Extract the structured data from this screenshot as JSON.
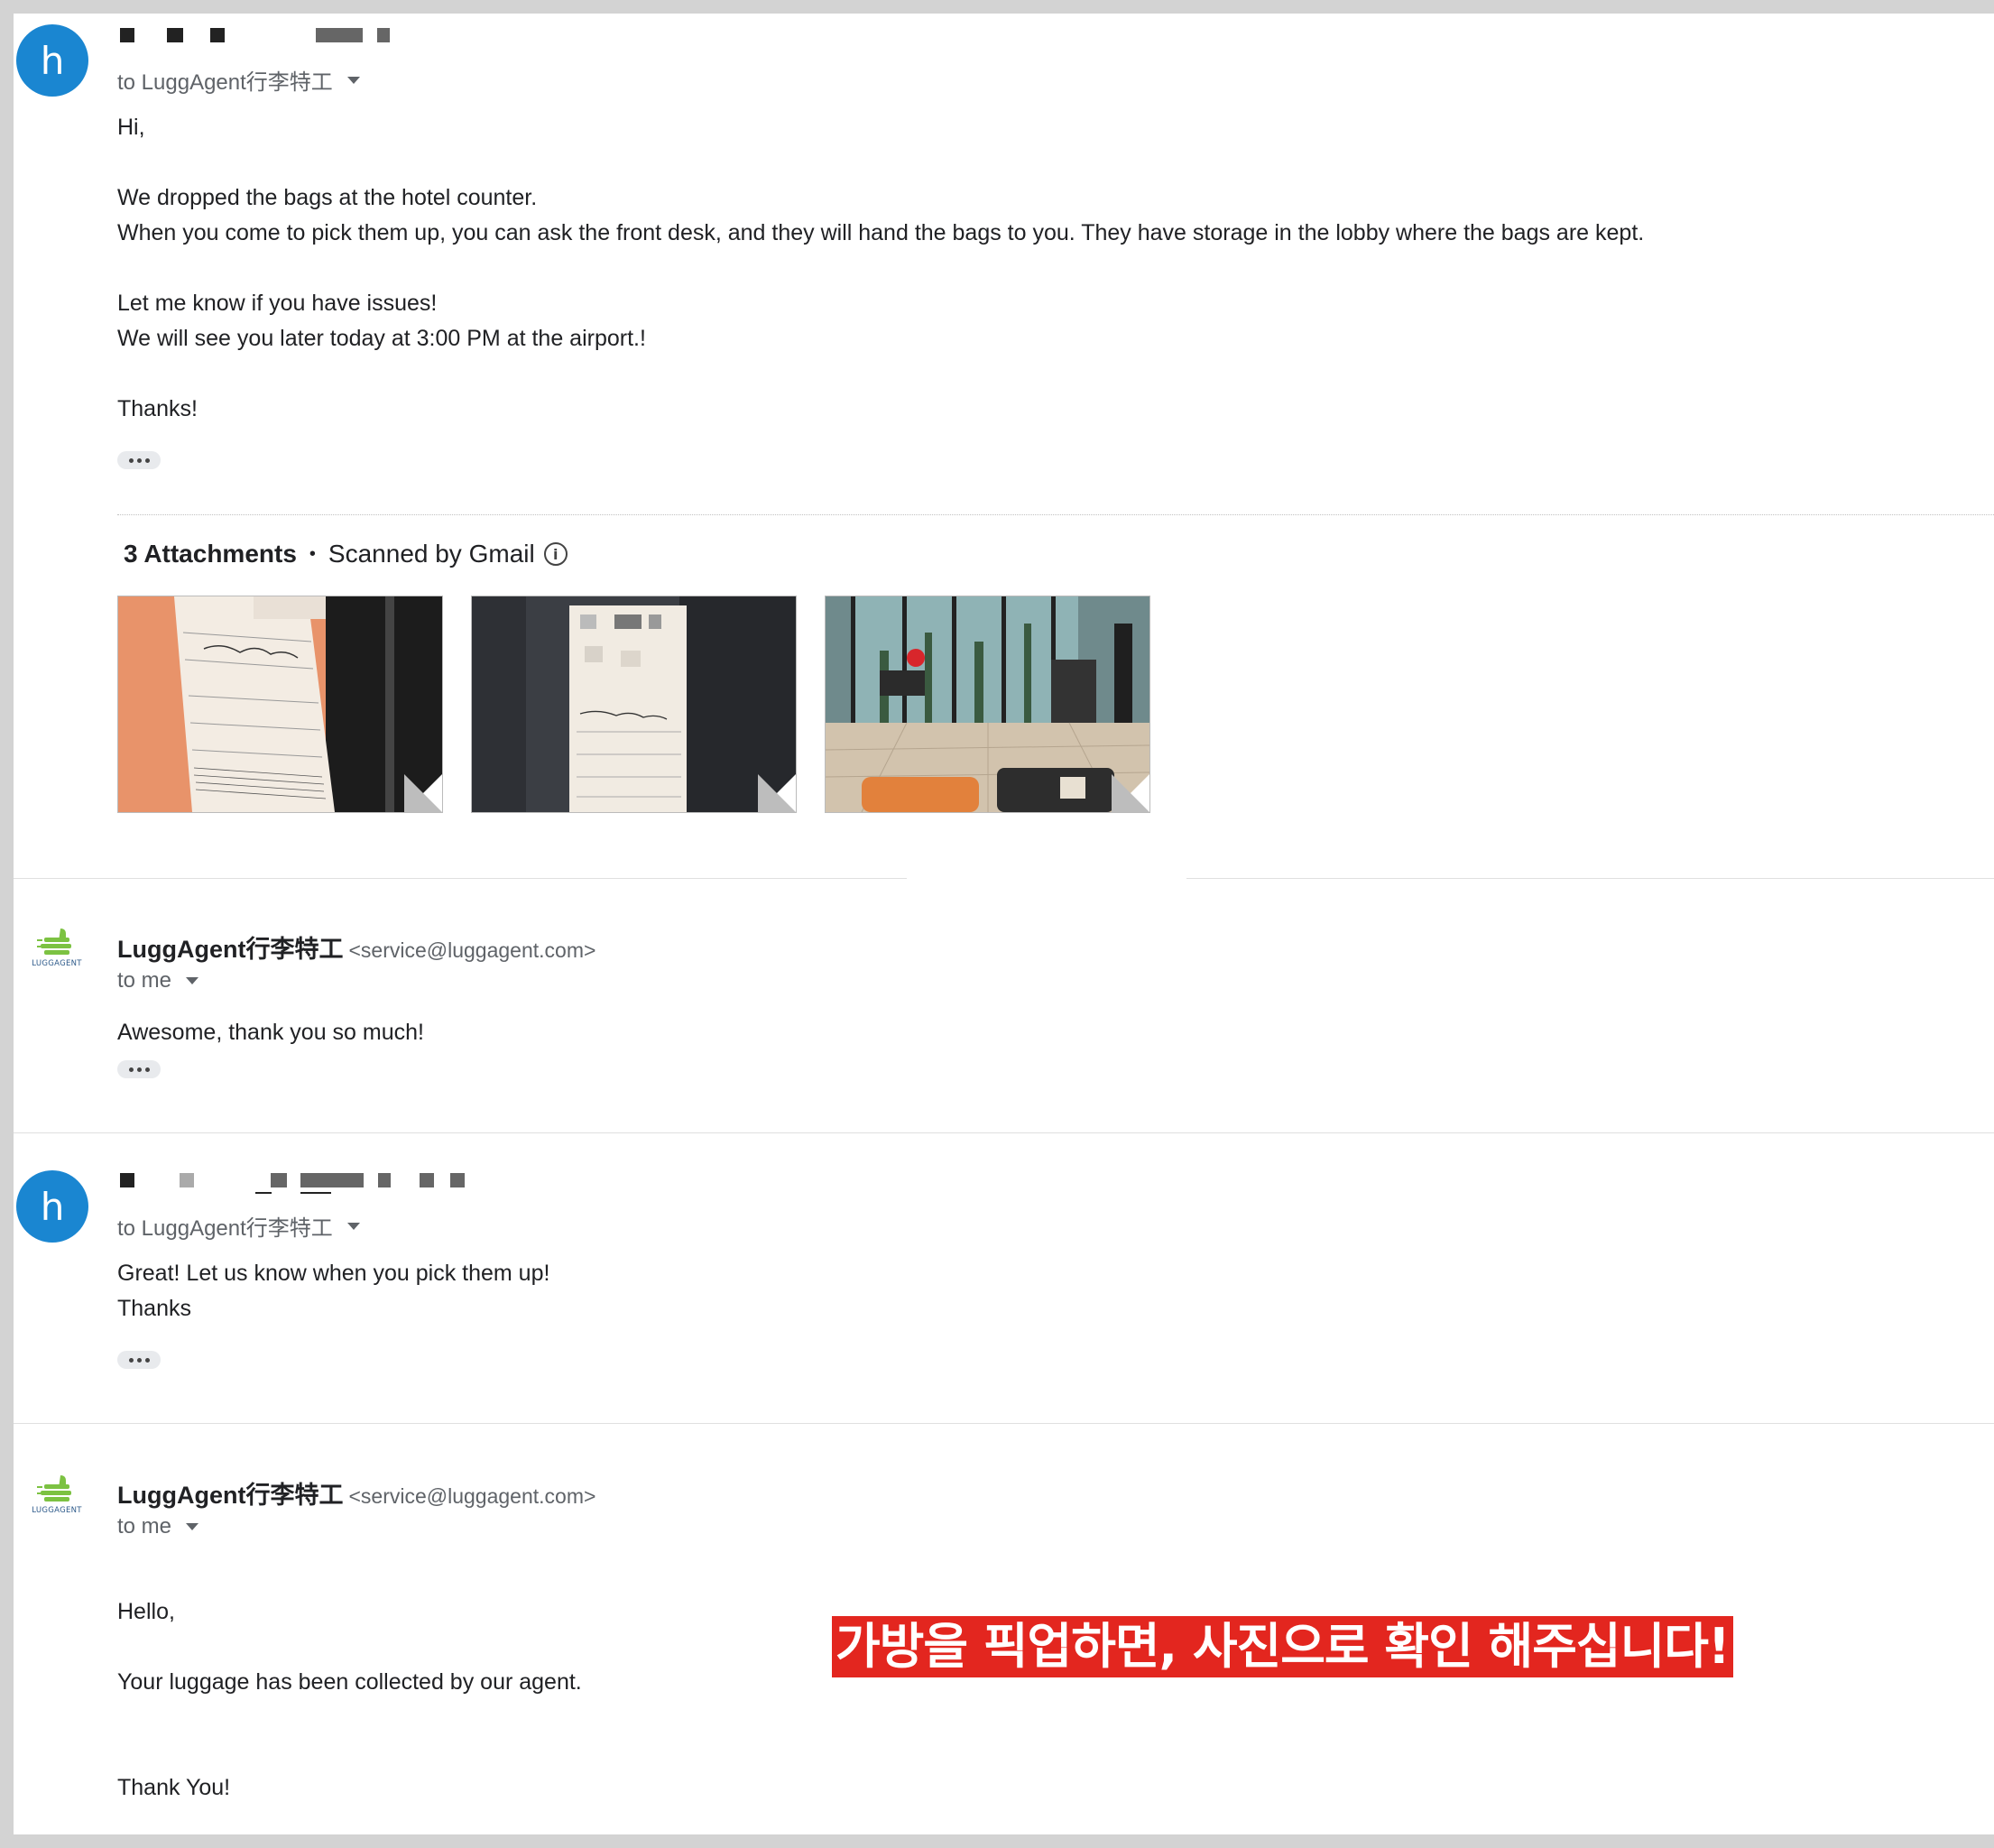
{
  "messages": [
    {
      "avatar_letter": "h",
      "recipient": "to LuggAgent行李特工",
      "body_lines": [
        "Hi,",
        "",
        "We dropped the bags at the hotel counter.",
        "When you come to pick them up, you can ask the front desk, and they will hand the bags to you. They have storage in the lobby where the bags are kept.",
        "",
        "Let me know if you have issues!",
        "We will see you later today at 3:00 PM at the airport.!",
        "",
        "Thanks!"
      ],
      "attachments": {
        "count_label": "3 Attachments",
        "bullet": "•",
        "scanned_label": "Scanned by Gmail",
        "info_glyph": "i"
      }
    },
    {
      "logo_text": "LUGGAGENT",
      "sender_name": "LuggAgent行李特工",
      "sender_email": "<service@luggagent.com>",
      "recipient": "to me",
      "body_lines": [
        "Awesome, thank you so much!"
      ]
    },
    {
      "avatar_letter": "h",
      "recipient": "to LuggAgent行李特工",
      "body_lines": [
        "Great! Let us know when you pick them up!",
        "Thanks"
      ]
    },
    {
      "logo_text": "LUGGAGENT",
      "sender_name": "LuggAgent行李特工",
      "sender_email": "<service@luggagent.com>",
      "recipient": "to me",
      "body_lines": [
        "Hello,",
        "",
        "Your luggage has been collected by our agent.",
        "",
        "",
        "Thank You!"
      ]
    }
  ],
  "banner": {
    "text": "가방을 픽업하면, 사진으로 확인 해주십니다!",
    "color": "#e3261f"
  },
  "colors": {
    "avatar": "#1a86d1",
    "logo_green": "#7cc242",
    "logo_blue": "#2d5a8a"
  }
}
